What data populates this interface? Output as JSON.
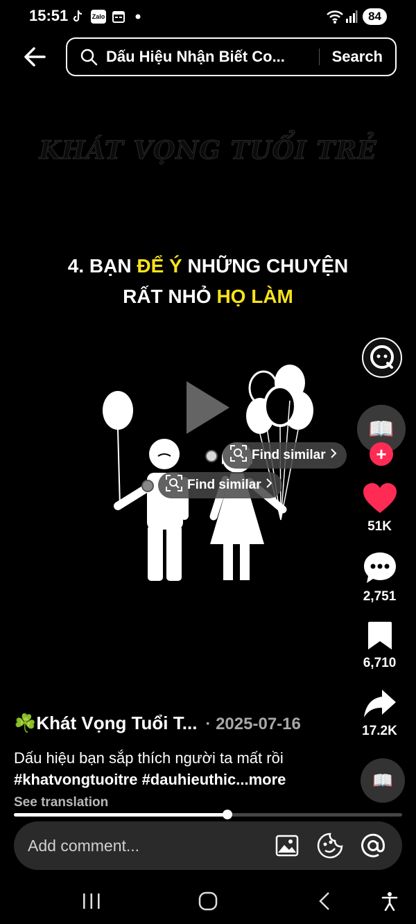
{
  "status": {
    "time": "15:51",
    "apps": [
      "tiktok-icon",
      "zalo-icon",
      "calendar-icon"
    ],
    "zalo_label": "Zalo",
    "battery": "84"
  },
  "search": {
    "query": "Dấu Hiệu Nhận Biết Co...",
    "button_label": "Search"
  },
  "video": {
    "watermark": "KHÁT VỌNG TUỔI TRẺ",
    "headline": {
      "line1_pre": "4. BẠN ",
      "line1_highlight": "ĐỂ Ý",
      "line1_post": " NHỮNG CHUYỆN",
      "line2_pre": "RẤT NHỎ ",
      "line2_highlight": "HỌ LÀM"
    },
    "find_similar_label": "Find similar",
    "accent_color": "#f7e21a"
  },
  "actions": {
    "likes": "51K",
    "comments": "2,751",
    "saves": "6,710",
    "shares": "17.2K",
    "like_color": "#ff2b55"
  },
  "caption": {
    "author": "☘️Khát Vọng Tuổi T...",
    "date": "· 2025-07-16",
    "text": "Dấu hiệu bạn sắp thích người ta mất rồi",
    "hashtags": "#khatvongtuoitre #dauhieuthic...",
    "more": "more",
    "see_translation": "See translation"
  },
  "playback": {
    "progress": 0.55
  },
  "comment": {
    "placeholder": "Add comment..."
  }
}
